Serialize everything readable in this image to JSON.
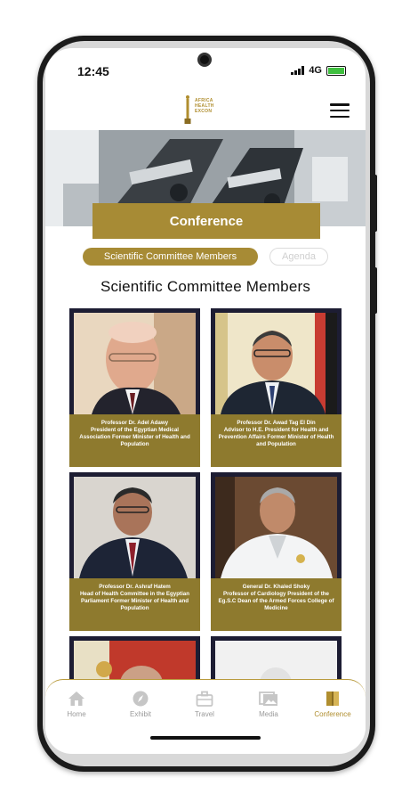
{
  "status_bar": {
    "time": "12:45",
    "network": "4G"
  },
  "header": {
    "logo_lines": [
      "AFRICA",
      "HEALTH",
      "EXCON"
    ]
  },
  "conference": {
    "title": "Conference"
  },
  "tabs": [
    {
      "label": "Scientific Committee Members",
      "active": true
    },
    {
      "label": "Agenda",
      "active": false
    }
  ],
  "section_title": "Scientific Committee Members",
  "members": [
    {
      "name": "Professor Dr. Adel Adawy",
      "role": "President of the Egyptian Medical Association Former Minister of Health and Population"
    },
    {
      "name": "Professor Dr. Awad Tag El Din",
      "role": "Advisor to H.E. President for Health and Prevention Affairs Former Minister of Health and Population"
    },
    {
      "name": "Professor Dr. Ashraf Hatem",
      "role": "Head of Health Committee in the Egyptian Parliament Former Minister of Health and Population"
    },
    {
      "name": "General Dr. Khaled Shoky",
      "role": "Professor of Cardiology President of the Eg.S.C Dean of the Armed Forces College of Medicine"
    }
  ],
  "bottom_nav": [
    {
      "label": "Home",
      "icon": "home-icon",
      "active": false
    },
    {
      "label": "Exhibit",
      "icon": "compass-icon",
      "active": false
    },
    {
      "label": "Travel",
      "icon": "briefcase-icon",
      "active": false
    },
    {
      "label": "Media",
      "icon": "gallery-icon",
      "active": false
    },
    {
      "label": "Conference",
      "icon": "book-icon",
      "active": true
    }
  ],
  "colors": {
    "accent_gold": "#a78b35",
    "caption_gold": "#8e7a2e",
    "card_frame": "#1d1d33"
  }
}
